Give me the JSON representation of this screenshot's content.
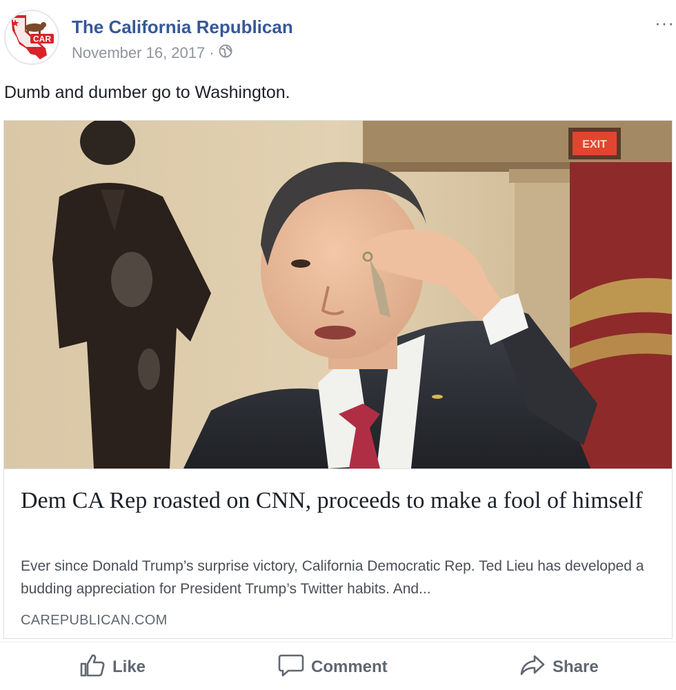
{
  "post": {
    "page_name": "The California Republican",
    "date": "November 16, 2017",
    "separator": "·",
    "audience_icon": "globe-icon",
    "more_label": "···",
    "message": "Dumb and dumber go to Washington.",
    "avatar_text": "CAR"
  },
  "link_card": {
    "title": "Dem CA Rep roasted on CNN, proceeds to make a fool of himself",
    "description": "Ever since Donald Trump’s surprise victory, California Democratic Rep. Ted Lieu has developed a budding appreciation for President Trump’s Twitter habits. And...",
    "domain": "CAREPUBLICAN.COM",
    "exit_sign": "EXIT"
  },
  "actions": {
    "like": "Like",
    "comment": "Comment",
    "share": "Share"
  },
  "colors": {
    "link_blue": "#365899",
    "meta_gray": "#90949c",
    "action_gray": "#606770",
    "brand_red": "#d8232a"
  }
}
